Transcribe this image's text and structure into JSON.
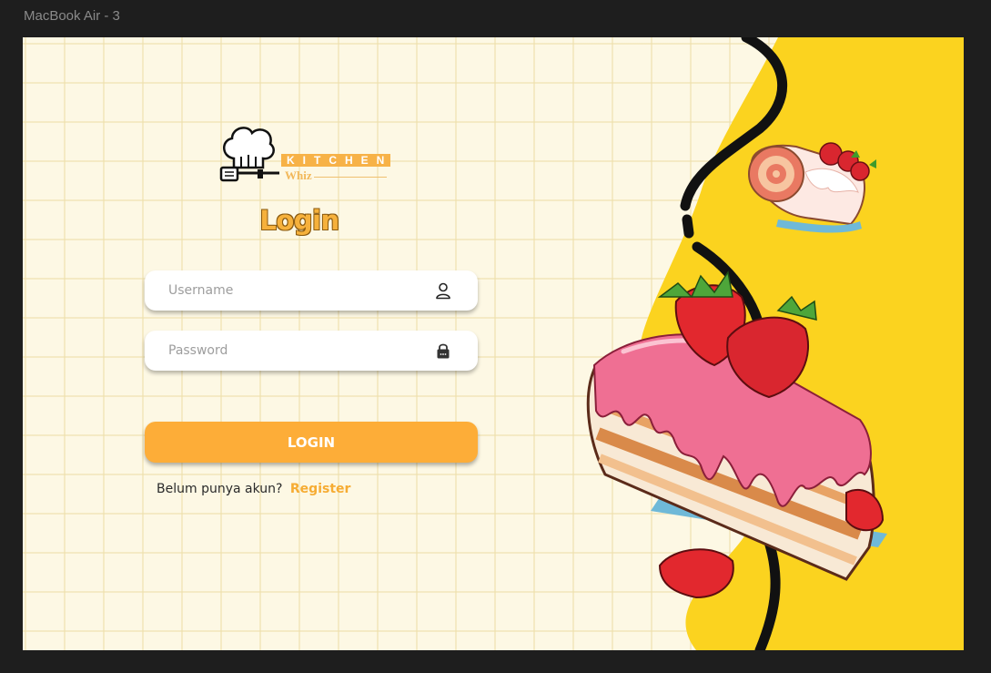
{
  "window": {
    "frame_title": "MacBook Air - 3"
  },
  "brand": {
    "logo_word": "KITCHEN",
    "logo_sub": "Whiz"
  },
  "login": {
    "title": "Login",
    "username_placeholder": "Username",
    "password_placeholder": "Password",
    "button_label": "LOGIN",
    "register_prompt": "Belum punya akun?",
    "register_link": "Register"
  },
  "icons": {
    "username": "user-icon",
    "password": "lock-icon",
    "logo": "chef-hat-icon",
    "decoration": "cake-illustration"
  },
  "colors": {
    "accent": "#fdad38",
    "link": "#f6ac33",
    "panel_yellow": "#fbd31f",
    "background": "#fdf8e4",
    "wave": "#111111"
  }
}
